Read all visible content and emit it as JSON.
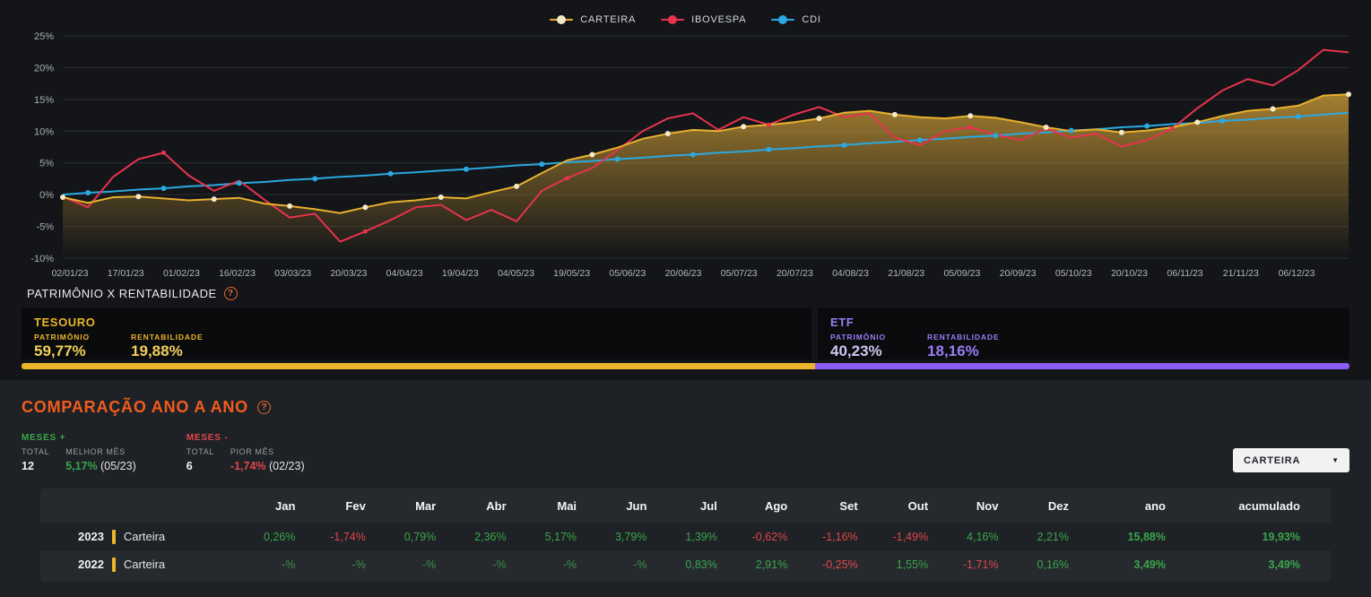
{
  "chart": {
    "legend": [
      {
        "label": "CARTEIRA",
        "line_color": "#e9b02e",
        "dot_color": "#f4e9c8"
      },
      {
        "label": "IBOVESPA",
        "line_color": "#e7334d",
        "dot_color": "#e7334d"
      },
      {
        "label": "CDI",
        "line_color": "#2ba9e0",
        "dot_color": "#2ba9e0"
      }
    ]
  },
  "chart_data": {
    "type": "line",
    "unit": "%",
    "ylim": [
      -10,
      25
    ],
    "y_ticks": [
      25,
      20,
      15,
      10,
      5,
      0,
      -5,
      -10
    ],
    "x_labels": [
      "02/01/23",
      "17/01/23",
      "01/02/23",
      "16/02/23",
      "03/03/23",
      "20/03/23",
      "04/04/23",
      "19/04/23",
      "04/05/23",
      "19/05/23",
      "05/06/23",
      "20/06/23",
      "05/07/23",
      "20/07/23",
      "04/08/23",
      "21/08/23",
      "05/09/23",
      "20/09/23",
      "05/10/23",
      "20/10/23",
      "06/11/23",
      "21/11/23",
      "06/12/23"
    ],
    "series": [
      {
        "name": "CARTEIRA",
        "color": "#e9b02e",
        "values": [
          -0.4,
          -1.3,
          -0.4,
          -0.3,
          -0.6,
          -0.9,
          -0.7,
          -0.5,
          -1.4,
          -1.8,
          -2.3,
          -2.9,
          -2.0,
          -1.2,
          -0.9,
          -0.4,
          -0.6,
          0.4,
          1.3,
          3.4,
          5.4,
          6.3,
          7.4,
          8.8,
          9.6,
          10.2,
          10.0,
          10.7,
          11.0,
          11.4,
          12.0,
          12.9,
          13.2,
          12.6,
          12.2,
          12.0,
          12.4,
          12.1,
          11.4,
          10.6,
          10.0,
          10.3,
          9.8,
          10.1,
          10.6,
          11.4,
          12.4,
          13.2,
          13.5,
          14.0,
          15.6,
          15.8
        ]
      },
      {
        "name": "IBOVESPA",
        "color": "#e7334d",
        "values": [
          -0.3,
          -2.0,
          2.8,
          5.6,
          6.6,
          3.0,
          0.6,
          2.2,
          -0.8,
          -3.6,
          -3.0,
          -7.4,
          -5.8,
          -4.0,
          -2.0,
          -1.6,
          -4.0,
          -2.4,
          -4.2,
          0.6,
          2.6,
          4.2,
          7.0,
          10.0,
          12.0,
          12.8,
          10.2,
          12.2,
          11.0,
          12.6,
          13.8,
          12.2,
          12.8,
          9.0,
          7.8,
          10.0,
          10.6,
          9.4,
          8.6,
          10.4,
          9.0,
          9.6,
          7.6,
          8.6,
          10.4,
          13.6,
          16.4,
          18.2,
          17.2,
          19.6,
          22.8,
          22.4
        ]
      },
      {
        "name": "CDI",
        "color": "#2ba9e0",
        "values": [
          0.0,
          0.3,
          0.5,
          0.8,
          1.0,
          1.3,
          1.5,
          1.8,
          2.0,
          2.3,
          2.5,
          2.8,
          3.0,
          3.3,
          3.5,
          3.8,
          4.0,
          4.3,
          4.6,
          4.8,
          5.1,
          5.3,
          5.6,
          5.8,
          6.1,
          6.3,
          6.6,
          6.8,
          7.1,
          7.3,
          7.6,
          7.8,
          8.1,
          8.3,
          8.6,
          8.8,
          9.1,
          9.3,
          9.6,
          9.8,
          10.1,
          10.3,
          10.6,
          10.8,
          11.1,
          11.3,
          11.6,
          11.8,
          12.1,
          12.3,
          12.6,
          12.9
        ]
      }
    ]
  },
  "patrimonio": {
    "section_title": "PATRIMÔNIO X RENTABILIDADE",
    "tesouro": {
      "title": "TESOURO",
      "patrimonio_label": "PATRIMÔNIO",
      "patrimonio_value": "59,77%",
      "rentabilidade_label": "RENTABILIDADE",
      "rentabilidade_value": "19,88%",
      "color": "#edb52b",
      "share": 59.77
    },
    "etf": {
      "title": "ETF",
      "patrimonio_label": "PATRIMÔNIO",
      "patrimonio_value": "40,23%",
      "rentabilidade_label": "RENTABILIDADE",
      "rentabilidade_value": "18,16%",
      "color": "#8a5cf6",
      "share": 40.23
    }
  },
  "comparison": {
    "title": "COMPARAÇÃO ANO A ANO",
    "positive": {
      "header": "MESES +",
      "total_label": "TOTAL",
      "total": "12",
      "best_label": "MELHOR MÊS",
      "best_value": "5,17%",
      "best_month": "(05/23)"
    },
    "negative": {
      "header": "MESES -",
      "total_label": "TOTAL",
      "total": "6",
      "worst_label": "PIOR MÊS",
      "worst_value": "-1,74%",
      "worst_month": "(02/23)"
    },
    "selector": {
      "label": "CARTEIRA"
    },
    "table": {
      "columns": [
        "Jan",
        "Fev",
        "Mar",
        "Abr",
        "Mai",
        "Jun",
        "Jul",
        "Ago",
        "Set",
        "Out",
        "Nov",
        "Dez",
        "ano",
        "acumulado"
      ],
      "rows": [
        {
          "year": "2023",
          "name": "Carteira",
          "values": [
            "0,26%",
            "-1,74%",
            "0,79%",
            "2,36%",
            "5,17%",
            "3,79%",
            "1,39%",
            "-0,62%",
            "-1,16%",
            "-1,49%",
            "4,16%",
            "2,21%"
          ],
          "year_total": "15,88%",
          "accumulated": "19,93%"
        },
        {
          "year": "2022",
          "name": "Carteira",
          "values": [
            "-%",
            "-%",
            "-%",
            "-%",
            "-%",
            "-%",
            "0,83%",
            "2,91%",
            "-0,25%",
            "1,55%",
            "-1,71%",
            "0,16%"
          ],
          "year_total": "3,49%",
          "accumulated": "3,49%"
        }
      ]
    }
  }
}
